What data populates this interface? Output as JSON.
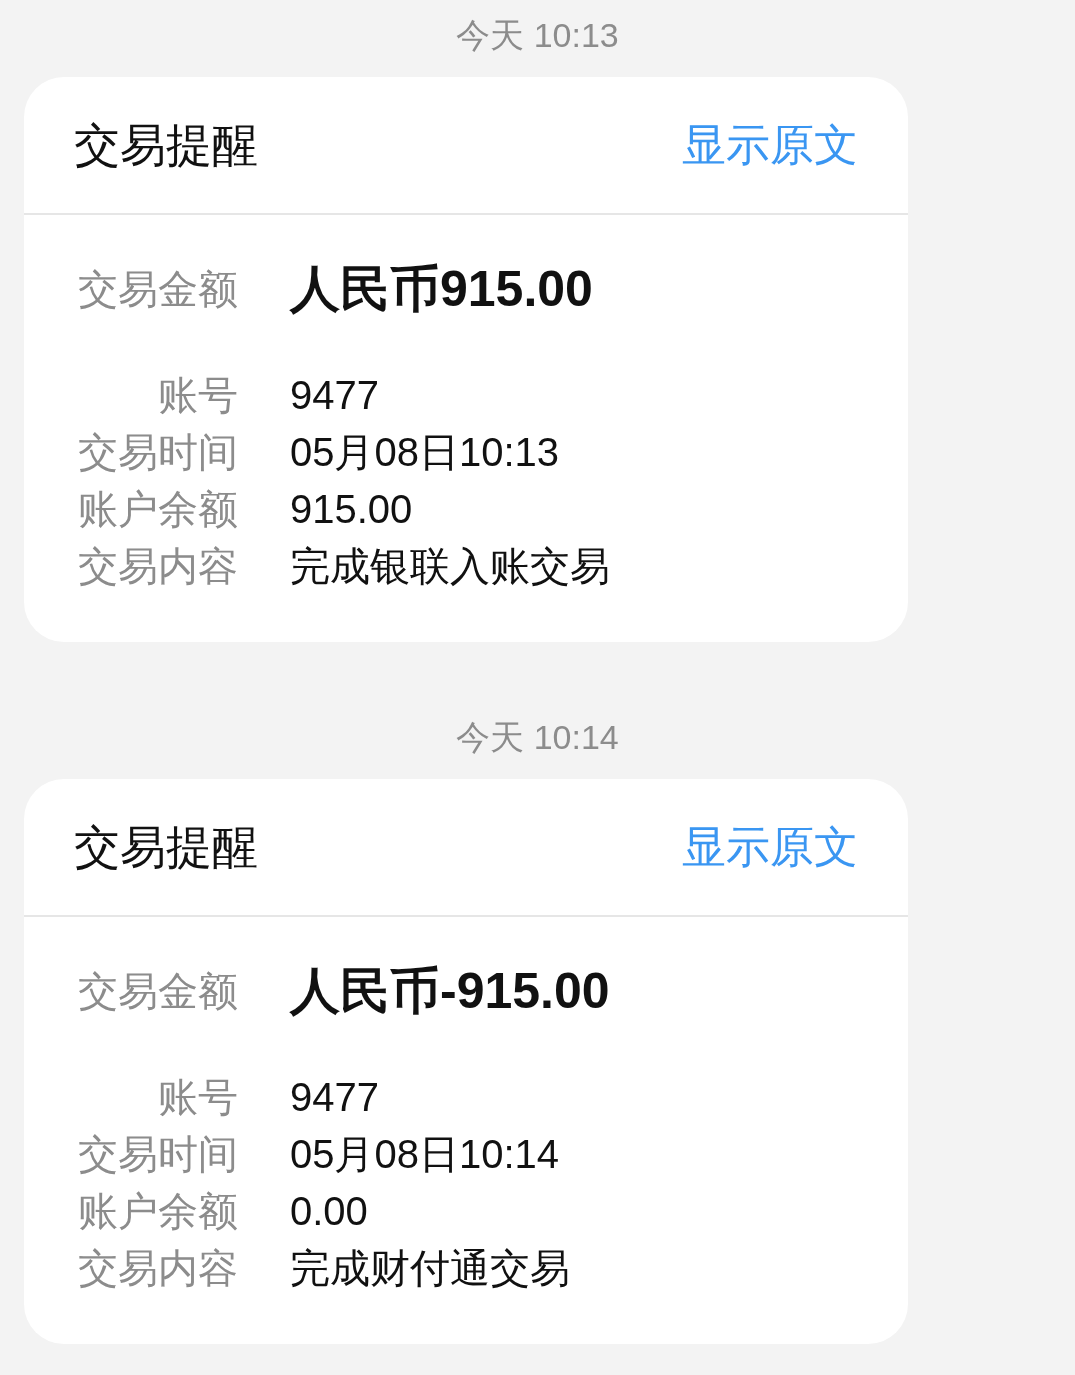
{
  "messages": [
    {
      "timestamp": "今天 10:13",
      "card": {
        "title": "交易提醒",
        "action": "显示原文",
        "amount": {
          "label": "交易金额",
          "value": "人民币915.00"
        },
        "fields": [
          {
            "label": "账号",
            "value": "9477"
          },
          {
            "label": "交易时间",
            "value": "05月08日10:13"
          },
          {
            "label": "账户余额",
            "value": "915.00"
          },
          {
            "label": "交易内容",
            "value": "完成银联入账交易"
          }
        ]
      }
    },
    {
      "timestamp": "今天 10:14",
      "card": {
        "title": "交易提醒",
        "action": "显示原文",
        "amount": {
          "label": "交易金额",
          "value": "人民币-915.00"
        },
        "fields": [
          {
            "label": "账号",
            "value": "9477"
          },
          {
            "label": "交易时间",
            "value": "05月08日10:14"
          },
          {
            "label": "账户余额",
            "value": "0.00"
          },
          {
            "label": "交易内容",
            "value": "完成财付通交易"
          }
        ]
      }
    }
  ]
}
